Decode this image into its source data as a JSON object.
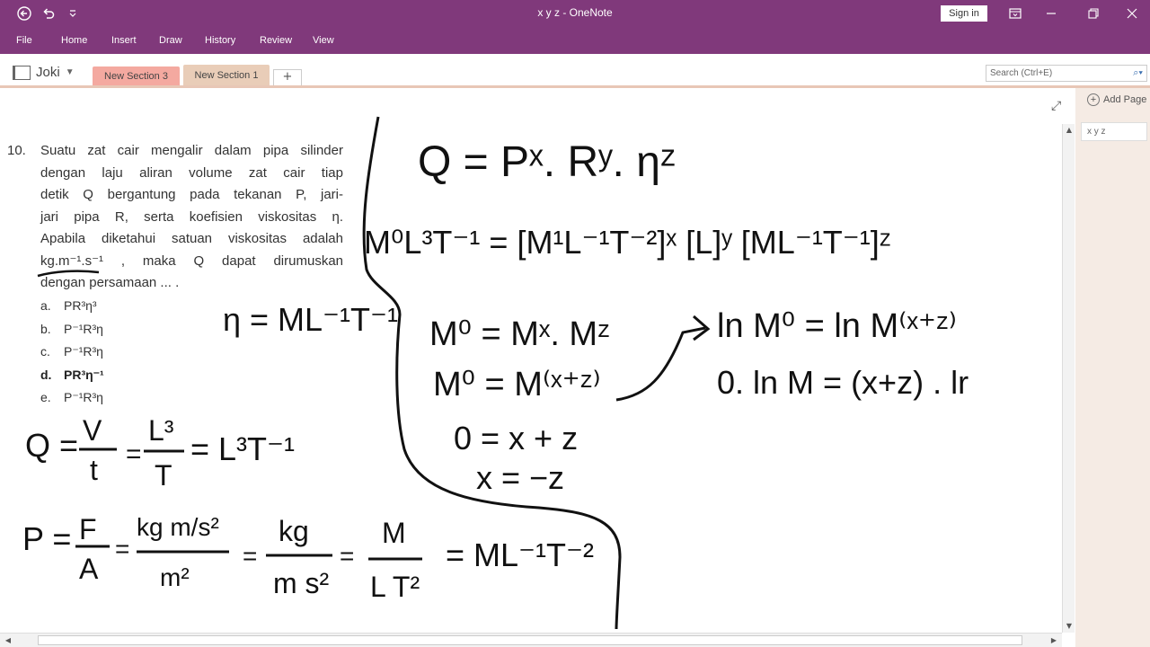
{
  "window": {
    "title": "x y z  -  OneNote",
    "signin_label": "Sign in"
  },
  "menu": [
    "File",
    "Home",
    "Insert",
    "Draw",
    "History",
    "Review",
    "View"
  ],
  "notebook": {
    "name": "Joki"
  },
  "sections": [
    {
      "label": "New Section 3",
      "color": "#f4a9a0"
    },
    {
      "label": "New Section 1",
      "color": "#e9cdb8"
    }
  ],
  "add_section_label": "+",
  "search": {
    "placeholder": "Search (Ctrl+E)"
  },
  "pages": {
    "add_label": "Add Page",
    "items": [
      "x y z"
    ]
  },
  "colors": {
    "accent": "#80397b",
    "ink": "#111111"
  },
  "problem": {
    "number": "10.",
    "lines": [
      "Suatu zat cair mengalir dalam pipa silinder",
      "dengan laju aliran volume zat cair tiap",
      "detik Q bergantung pada tekanan P, jari-",
      "jari pipa R, serta koefisien viskositas η.",
      "Apabila diketahui satuan viskositas adalah",
      "kg.m⁻¹.s⁻¹ , maka Q dapat dirumuskan",
      "dengan persamaan ... ."
    ],
    "options": [
      {
        "letter": "a.",
        "text": "PR³η³",
        "bold": false
      },
      {
        "letter": "b.",
        "text": "P⁻¹R³η",
        "bold": false
      },
      {
        "letter": "c.",
        "text": "P⁻¹R³η",
        "bold": false
      },
      {
        "letter": "d.",
        "text": "PR³η⁻¹",
        "bold": true
      },
      {
        "letter": "e.",
        "text": "P⁻¹R³η",
        "bold": false
      }
    ]
  },
  "handwriting": {
    "eta_dim": "η = ML⁻¹T⁻¹",
    "q_dim_q": "Q =",
    "q_dim_v": "V",
    "q_dim_t": "t",
    "q_dim_l3": "L³",
    "q_dim_T": "T",
    "q_dim_result": "= L³T⁻¹",
    "p_dim_p": "P =",
    "p_dim_f": "F",
    "p_dim_a": "A",
    "p_dim_kgms": "kg m/s²",
    "p_dim_m2": "m²",
    "p_dim_kg": "kg",
    "p_dim_ms2": "m s²",
    "p_dim_M": "M",
    "p_dim_LT2": "L T²",
    "p_dim_result": "= ML⁻¹T⁻²",
    "eq_main": "Q = Pˣ. Rʸ. ηᶻ",
    "eq_dims": "M⁰L³T⁻¹ = [M¹L⁻¹T⁻²]ˣ [L]ʸ [ML⁻¹T⁻¹]ᶻ",
    "eq_m1": "M⁰ = Mˣ. Mᶻ",
    "eq_m2": "M⁰ = M⁽ˣ⁺ᶻ⁾",
    "eq_m3": "0 = x + z",
    "eq_m4": "x = −z",
    "eq_ln1": "ln M⁰ = ln M⁽ˣ⁺ᶻ⁾",
    "eq_ln2": "0. ln M = (x+z) . lr"
  }
}
